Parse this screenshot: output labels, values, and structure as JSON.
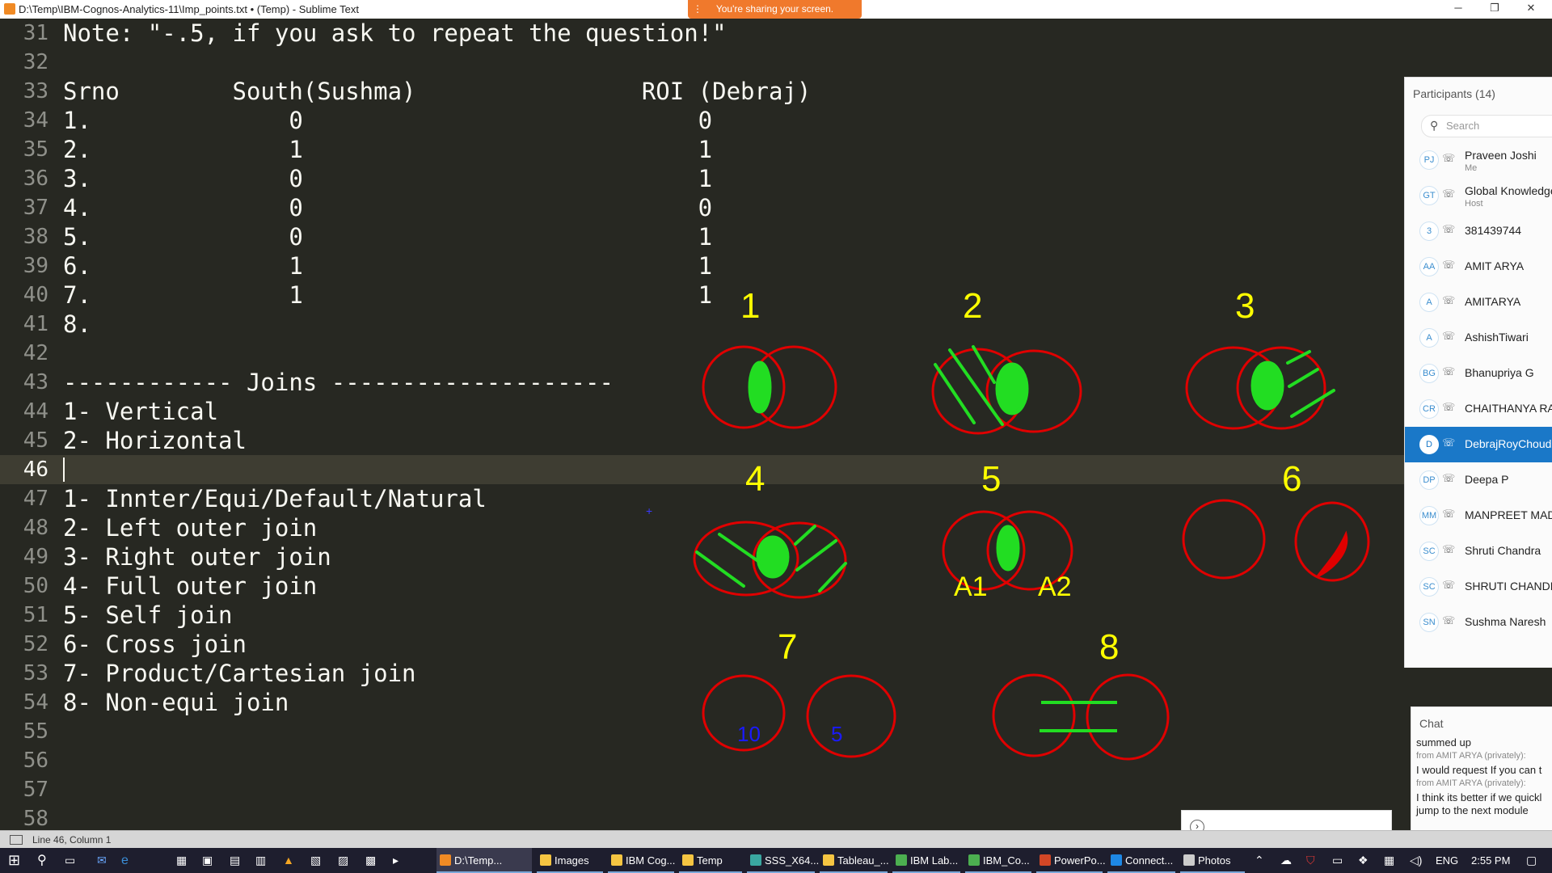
{
  "window": {
    "title": "D:\\Temp\\IBM-Cognos-Analytics-11\\Imp_points.txt • (Temp) - Sublime Text",
    "share_banner": "You're sharing your screen.",
    "minimize": "─",
    "restore": "❐",
    "close": "✕"
  },
  "editor": {
    "line_numbers": [
      "31",
      "32",
      "33",
      "34",
      "35",
      "36",
      "37",
      "38",
      "39",
      "40",
      "41",
      "42",
      "43",
      "44",
      "45",
      "46",
      "47",
      "48",
      "49",
      "50",
      "51",
      "52",
      "53",
      "54",
      "55",
      "56",
      "57",
      "58"
    ],
    "active_line": "46",
    "lines": [
      "Note: \"-.5, if you ask to repeat the question!\"",
      "",
      "Srno        South(Sushma)                ROI (Debraj)",
      "1.              0                            0",
      "2.              1                            1",
      "3.              0                            1",
      "4.              0                            0",
      "5.              0                            1",
      "6.              1                            1",
      "7.              1                            1",
      "8.",
      "",
      "------------ Joins --------------------",
      "1- Vertical",
      "2- Horizontal",
      "",
      "1- Innter/Equi/Default/Natural",
      "2- Left outer join",
      "3- Right outer join",
      "4- Full outer join",
      "5- Self join",
      "6- Cross join",
      "7- Product/Cartesian join",
      "8- Non-equi join",
      "",
      "",
      "",
      ""
    ]
  },
  "drawing": {
    "numbers": [
      "1",
      "2",
      "3",
      "4",
      "5",
      "6",
      "7",
      "8"
    ],
    "circle5_left": "A1",
    "circle5_right": "A2",
    "circle7_left": "10",
    "circle7_right": "5",
    "colors": {
      "circle": "#e00000",
      "fill": "#22dd22",
      "number": "#ffff00",
      "label": "#ffff00",
      "small": "#1a1aff"
    }
  },
  "participants": {
    "header": "Participants (14)",
    "search_placeholder": "Search",
    "list": [
      {
        "initials": "PJ",
        "name": "Praveen Joshi",
        "role": "Me"
      },
      {
        "initials": "GT",
        "name": "Global Knowledge",
        "role": "Host"
      },
      {
        "initials": "3",
        "name": "381439744",
        "role": ""
      },
      {
        "initials": "AA",
        "name": "AMIT ARYA",
        "role": ""
      },
      {
        "initials": "A",
        "name": "AMITARYA",
        "role": ""
      },
      {
        "initials": "A",
        "name": "AshishTiwari",
        "role": ""
      },
      {
        "initials": "BG",
        "name": "Bhanupriya G",
        "role": ""
      },
      {
        "initials": "CR",
        "name": "CHAITHANYA RA",
        "role": ""
      },
      {
        "initials": "D",
        "name": "DebrajRoyChoudh",
        "role": ""
      },
      {
        "initials": "DP",
        "name": "Deepa P",
        "role": ""
      },
      {
        "initials": "MM",
        "name": "MANPREET MAD",
        "role": ""
      },
      {
        "initials": "SC",
        "name": "Shruti Chandra",
        "role": ""
      },
      {
        "initials": "SC",
        "name": "SHRUTI CHANDR",
        "role": ""
      },
      {
        "initials": "SN",
        "name": "Sushma Naresh",
        "role": ""
      }
    ],
    "selected_index": 8
  },
  "chat": {
    "header": "Chat",
    "lines": [
      {
        "type": "msg",
        "text": "summed up"
      },
      {
        "type": "meta",
        "text": "from AMIT ARYA (privately):"
      },
      {
        "type": "msg",
        "text": "I would request If you can t"
      },
      {
        "type": "meta",
        "text": "from AMIT ARYA (privately):"
      },
      {
        "type": "msg",
        "text": "I think its better if we quickl"
      },
      {
        "type": "msg",
        "text": "jump to the next module"
      }
    ]
  },
  "statusbar": {
    "position": "Line 46, Column 1"
  },
  "taskbar": {
    "items": [
      {
        "label": "D:\\Temp...",
        "color": "#f08a24",
        "active": true
      },
      {
        "label": "Images",
        "color": "#f5c542",
        "active": false
      },
      {
        "label": "IBM Cog...",
        "color": "#f5c542",
        "active": false
      },
      {
        "label": "Temp",
        "color": "#f5c542",
        "active": false
      },
      {
        "label": "SSS_X64...",
        "color": "#3aa7a0",
        "active": false
      },
      {
        "label": "Tableau_...",
        "color": "#f5c542",
        "active": false
      },
      {
        "label": "IBM Lab...",
        "color": "#4caf50",
        "active": false
      },
      {
        "label": "IBM_Co...",
        "color": "#4caf50",
        "active": false
      },
      {
        "label": "PowerPo...",
        "color": "#d24726",
        "active": false
      },
      {
        "label": "Connect...",
        "color": "#1e88e5",
        "active": false
      },
      {
        "label": "Photos",
        "color": "#cccccc",
        "active": false
      }
    ],
    "lang": "ENG",
    "time": "2:55 PM"
  }
}
